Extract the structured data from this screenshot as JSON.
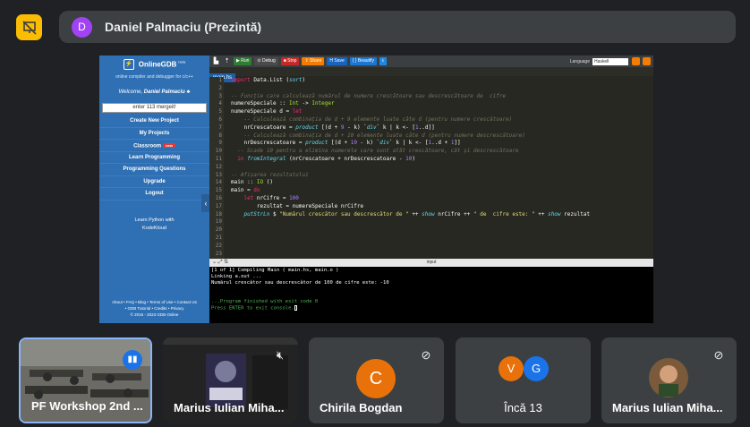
{
  "presenter": {
    "avatar_letter": "D",
    "name": "Daniel Palmaciu (Prezintă)"
  },
  "sidebar": {
    "brand": "OnlineGDB",
    "brand_sup": "beta",
    "subtitle": "online compiler and debugger for c/c++",
    "welcome_prefix": "Welcome, ",
    "welcome_user": "Daniel Palmaciu ♣",
    "search_value": "enter 113 mergeit!",
    "menu": [
      {
        "label": "Create New Project"
      },
      {
        "label": "My Projects"
      },
      {
        "label": "Classroom",
        "badge": "new"
      },
      {
        "label": "Learn Programming"
      },
      {
        "label": "Programming Questions"
      },
      {
        "label": "Upgrade"
      },
      {
        "label": "Logout"
      }
    ],
    "promo_line1": "Learn Python with",
    "promo_line2": "KodeKloud",
    "footer_line1": "About • FAQ • Blog • Terms of Use • Contact Us",
    "footer_line2": "• GDB Tutorial • Credits • Privacy",
    "footer_line3": "© 2016 - 2023 GDB Online"
  },
  "toolbar": {
    "run": "▶ Run",
    "debug": "⊙ Debug",
    "stop": "■ Stop",
    "share": "⇪ Share",
    "save": "H Save",
    "beautify": "{ } Beautify",
    "download": "⭳",
    "language_label": "Language",
    "language_value": "Haskell"
  },
  "file_tab": "main.hs",
  "code_lines": [
    "import Data.List (sort)",
    "",
    "-- Funcție care calculează numărul de numere crescătoare sau descrescătoare de  cifre",
    "numereSpeciale :: Int -> Integer",
    "numereSpeciale d = let",
    "    -- Calculează combinația de d + 9 elemente luate câte d (pentru numere crescătoare)",
    "    nrCrescatoare = product [(d + 9 - k) `div` k | k <- [1..d]]",
    "    -- Calculează combinația de d + 10 elemente luate câte d (pentru numere descrescătoare)",
    "    nrDescrescatoare = product [(d + 10 - k) `div` k | k <- [1..d + 1]]",
    "  -- Scade 10 pentru a elimina numerele care sunt atât crescătoare, cât și descrescătoare",
    "  in fromIntegral (nrCrescatoare + nrDescrescatoare - 10)",
    "",
    "-- Afișarea rezultatului",
    "main :: IO ()",
    "main = do",
    "    let nrCifre = 100",
    "        rezultat = numereSpeciale nrCifre",
    "    putStrLn $ \"Numărul crescător sau descrescător de \" ++ show nrCifre ++ \" de  cifre este: \" ++ show rezultat",
    "",
    "",
    "",
    "",
    ""
  ],
  "console": {
    "title": "input",
    "lines": [
      "[1 of 1] Compiling Main             ( main.hs, main.o )",
      "Linking a.out ...",
      "Numărul crescător sau descrescător de 100 de  cifre este: -10",
      "",
      "",
      "...Program finished with exit code 0",
      "Press ENTER to exit console."
    ]
  },
  "tiles": [
    {
      "name": "PF Workshop 2nd ..."
    },
    {
      "name": "Marius Iulian Miha..."
    },
    {
      "name": "Chirila Bogdan",
      "avatar_letter": "C",
      "avatar_color": "#e8710a"
    },
    {
      "name": "Încă 13",
      "avatar_letters": [
        "V",
        "G"
      ],
      "avatar_colors": [
        "#e8710a",
        "#1a73e8"
      ]
    },
    {
      "name": "Marius Iulian Miha..."
    }
  ]
}
